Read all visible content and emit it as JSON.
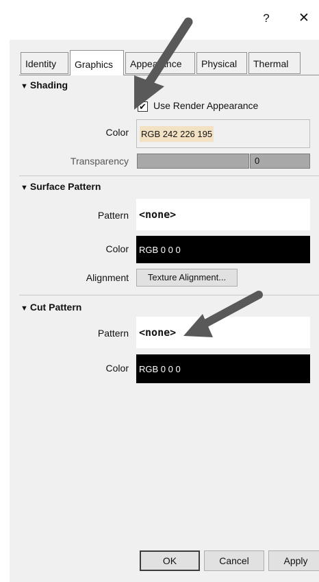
{
  "titlebar": {
    "help_label": "?",
    "close_label": "✕"
  },
  "tabs": [
    {
      "label": "Identity",
      "active": false
    },
    {
      "label": "Graphics",
      "active": true
    },
    {
      "label": "Appearance",
      "active": false
    },
    {
      "label": "Physical",
      "active": false
    },
    {
      "label": "Thermal",
      "active": false
    }
  ],
  "shading": {
    "heading": "Shading",
    "use_render_appearance_label": "Use Render Appearance",
    "use_render_appearance_checked": true,
    "color_label": "Color",
    "color_value": "RGB 242 226 195",
    "color_swatch": "#f2e2c3",
    "transparency_label": "Transparency",
    "transparency_value": "0"
  },
  "surface_pattern": {
    "heading": "Surface Pattern",
    "pattern_label": "Pattern",
    "pattern_value": "<none>",
    "color_label": "Color",
    "color_value": "RGB 0 0 0",
    "alignment_label": "Alignment",
    "alignment_button": "Texture Alignment..."
  },
  "cut_pattern": {
    "heading": "Cut Pattern",
    "pattern_label": "Pattern",
    "pattern_value": "<none>",
    "color_label": "Color",
    "color_value": "RGB 0 0 0"
  },
  "footer": {
    "ok_label": "OK",
    "cancel_label": "Cancel",
    "apply_label": "Apply"
  },
  "colors": {
    "panel_bg": "#f0f0f0",
    "arrow": "#595959",
    "black_swatch": "#000000"
  }
}
